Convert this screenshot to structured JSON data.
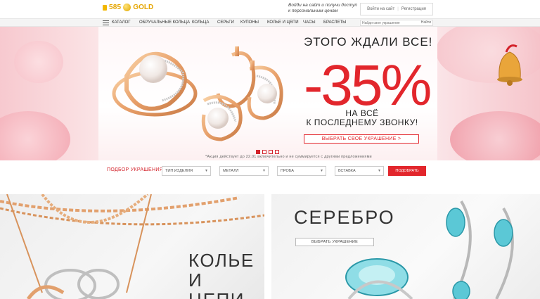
{
  "header": {
    "logo_number": "585",
    "logo_word": "GOLD",
    "login_promo": "Войди на сайт и получи доступ к персональным ценам",
    "login_link": "Войти на сайт",
    "register_link": "Регистрация"
  },
  "nav": {
    "items": [
      "Каталог",
      "Обручальные кольца",
      "Кольца",
      "Серьги",
      "Купоны",
      "Колье и цепи",
      "Часы",
      "Браслеты"
    ],
    "search_placeholder": "Найди свое украшение",
    "search_button": "Найти"
  },
  "hero": {
    "title": "ЭТОГО ЖДАЛИ ВСЕ!",
    "discount": "-35%",
    "subtitle_line1": "НА ВСЁ",
    "subtitle_line2": "К ПОСЛЕДНЕМУ ЗВОНКУ!",
    "button": "ВЫБРАТЬ СВОЕ УКРАШЕНИЕ >",
    "note": "*Акция действует до 22.01 включительно и не суммируется с другими предложениями",
    "slides_total": 4,
    "slide_active": 1
  },
  "filter": {
    "label": "Подбор украшения",
    "selects": [
      "Тип изделия",
      "Металл",
      "Проба",
      "Вставка"
    ],
    "button": "Подобрать"
  },
  "cards": {
    "left_title_line1": "КОЛЬЕ",
    "left_title_line2": "И ЦЕПИ",
    "right_title": "СЕРЕБРО",
    "right_button": "Выбрать украшение"
  },
  "colors": {
    "accent_red": "#e2262c",
    "gold": "#e5a500"
  }
}
